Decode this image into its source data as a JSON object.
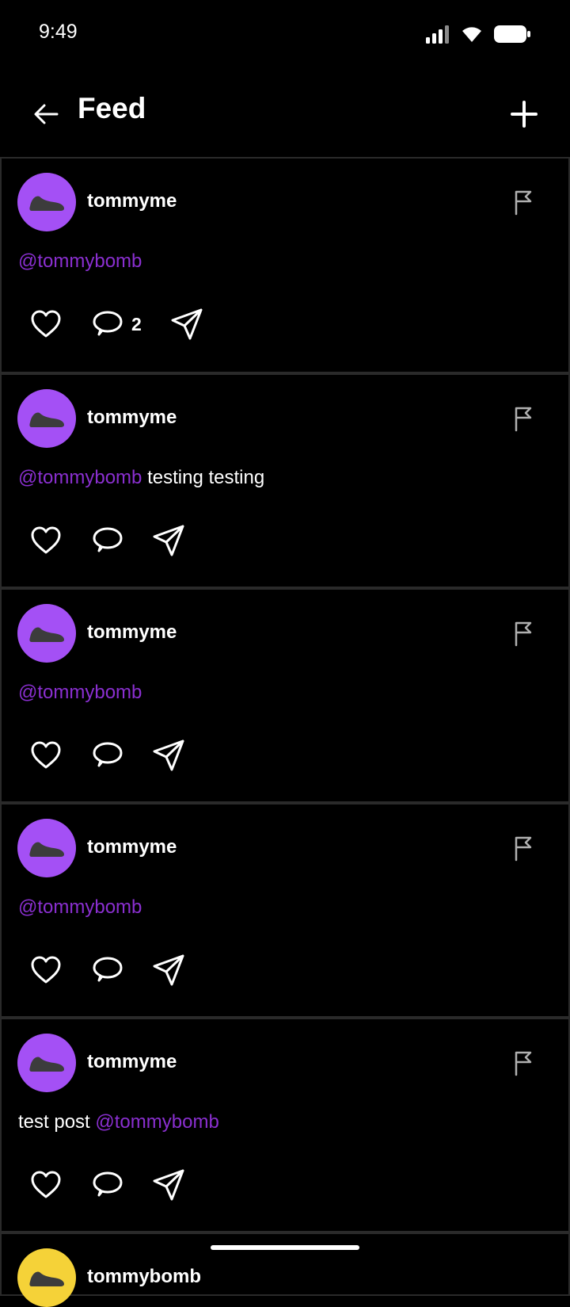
{
  "status": {
    "time": "9:49"
  },
  "header": {
    "title": "Feed"
  },
  "posts": [
    {
      "username": "tommyme",
      "segments": [
        {
          "text": "@tommybomb",
          "mention": true
        }
      ],
      "comment_count": "2"
    },
    {
      "username": "tommyme",
      "segments": [
        {
          "text": "@tommybomb",
          "mention": true
        },
        {
          "text": " testing testing",
          "mention": false
        }
      ],
      "comment_count": ""
    },
    {
      "username": "tommyme",
      "segments": [
        {
          "text": "@tommybomb",
          "mention": true
        }
      ],
      "comment_count": ""
    },
    {
      "username": "tommyme",
      "segments": [
        {
          "text": "@tommybomb",
          "mention": true
        }
      ],
      "comment_count": ""
    },
    {
      "username": "tommyme",
      "segments": [
        {
          "text": "test post ",
          "mention": false
        },
        {
          "text": "@tommybomb",
          "mention": true
        }
      ],
      "comment_count": ""
    },
    {
      "username": "tommybomb",
      "segments": [],
      "comment_count": ""
    }
  ],
  "colors": {
    "background": "#000000",
    "mention": "#8a2fd0",
    "avatar_purple": "#a450f5",
    "avatar_yellow": "#f5d238",
    "divider": "#2a2a2a"
  },
  "icons": {
    "back": "arrow-left-icon",
    "add": "plus-icon",
    "flag": "flag-icon",
    "like": "heart-icon",
    "comment": "comment-bubble-icon",
    "share": "send-icon",
    "avatar": "shoe-icon"
  }
}
